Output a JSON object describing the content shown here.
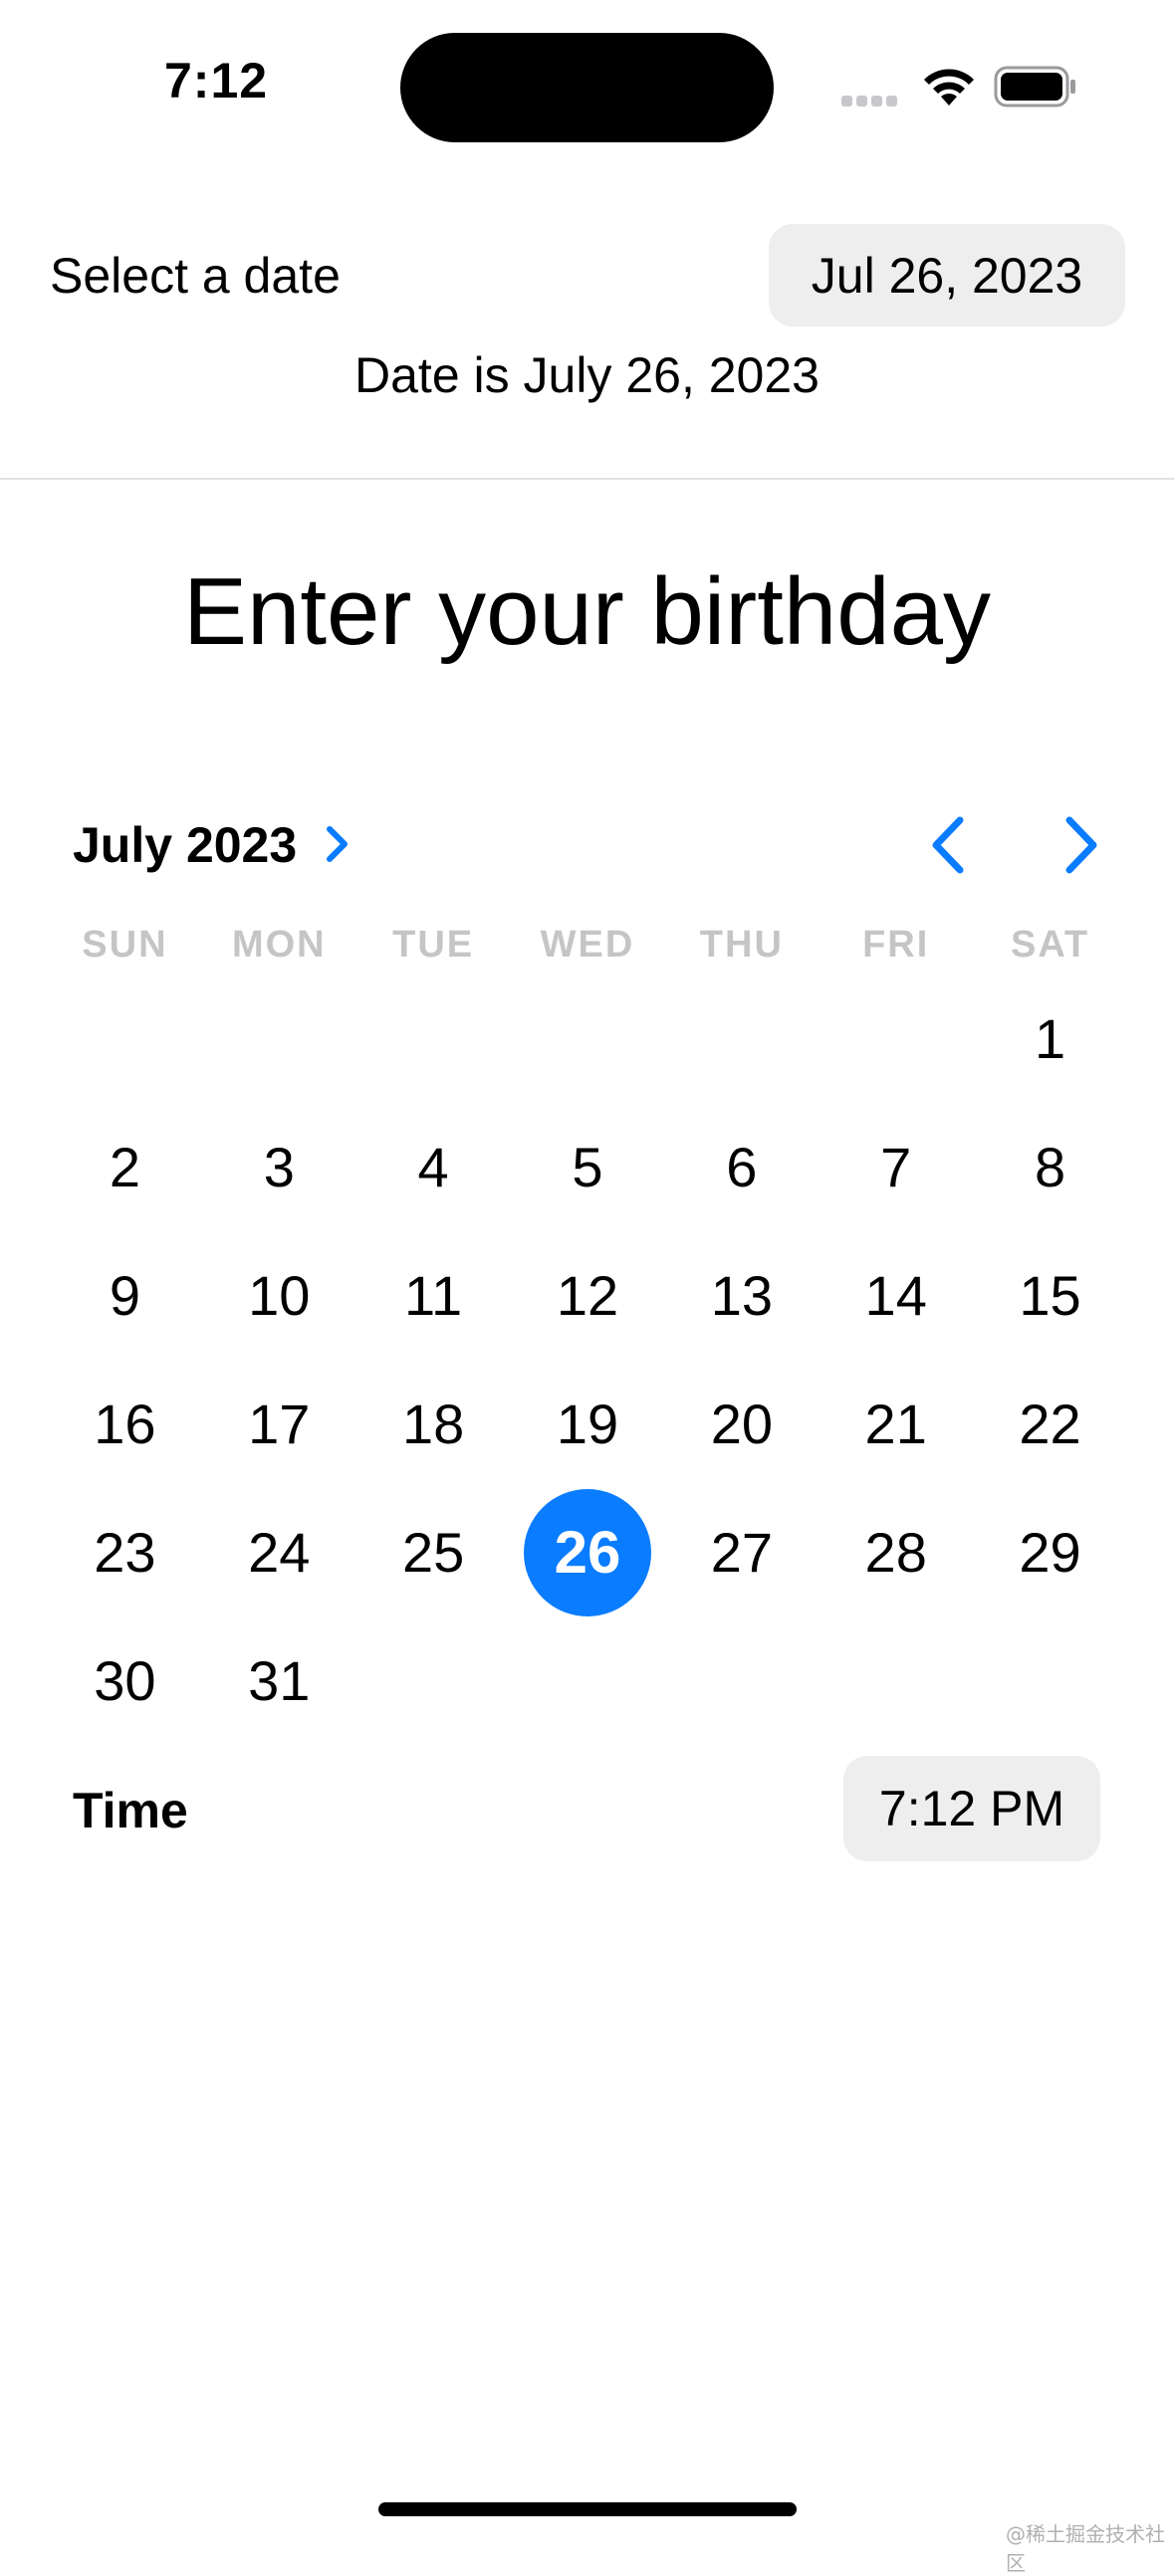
{
  "status_bar": {
    "time": "7:12"
  },
  "header": {
    "select_label": "Select a date",
    "date_value": "Jul 26, 2023",
    "date_is": "Date is July 26, 2023"
  },
  "title": "Enter your birthday",
  "calendar": {
    "month_label": "July 2023",
    "weekdays": [
      "SUN",
      "MON",
      "TUE",
      "WED",
      "THU",
      "FRI",
      "SAT"
    ],
    "leading_blank_days": 6,
    "days_in_month": 31,
    "selected_day": 26,
    "accent_color": "#0a7cff",
    "icons": {
      "month_expand": "chevron-right-icon",
      "previous": "chevron-left-icon",
      "next": "chevron-right-icon"
    }
  },
  "time_row": {
    "label": "Time",
    "value": "7:12 PM"
  },
  "watermark": "@稀土掘金技术社区"
}
